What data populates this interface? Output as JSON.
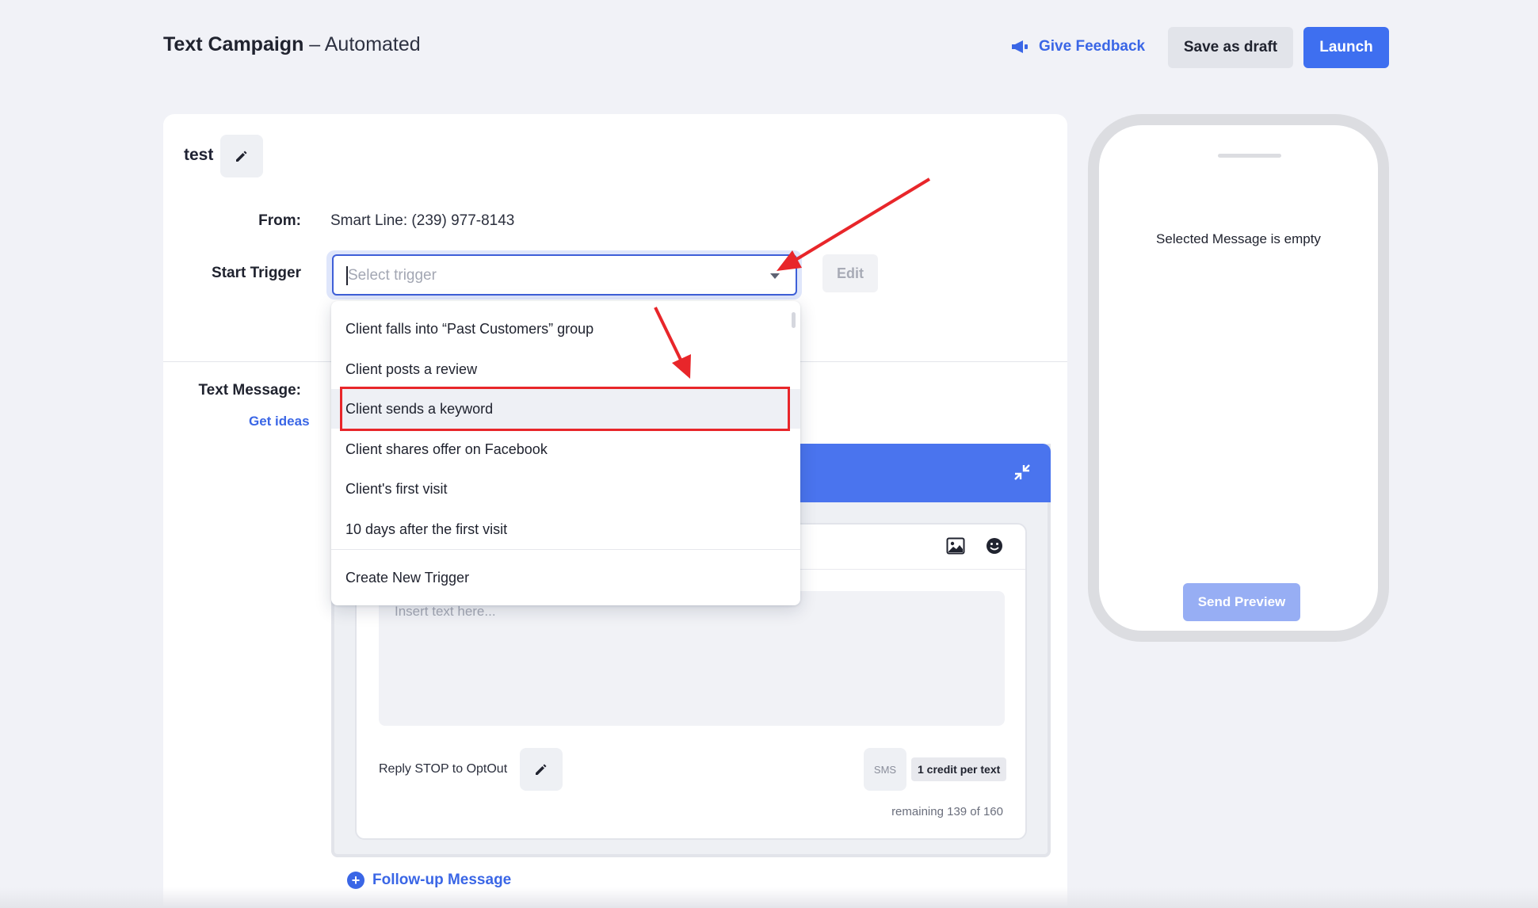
{
  "header": {
    "title_bold": "Text Campaign",
    "title_rest": " – Automated",
    "feedback_label": "Give Feedback",
    "save_draft_label": "Save as draft",
    "launch_label": "Launch"
  },
  "campaign": {
    "name": "test",
    "from_label": "From:",
    "from_value": "Smart Line: (239) 977-8143",
    "trigger_label": "Start Trigger",
    "trigger_placeholder": "Select trigger",
    "trigger_edit_label": "Edit",
    "message_label": "Text Message:",
    "get_ideas_label": "Get ideas"
  },
  "dropdown": {
    "items": [
      "Client falls into “Past Customers” group",
      "Client posts a review",
      "Client sends a keyword",
      "Client shares offer on Facebook",
      "Client's first visit",
      "10 days after the first visit"
    ],
    "highlighted_index": 2,
    "create_label": "Create New Trigger"
  },
  "editor": {
    "text_placeholder": "Insert text here...",
    "reply_stop": "Reply STOP to OptOut",
    "sms_label": "SMS",
    "credit_label": "1 credit per text",
    "remaining": "remaining 139 of 160",
    "followup_label": "Follow-up Message"
  },
  "preview": {
    "empty_message": "Selected Message is empty",
    "send_preview_label": "Send Preview"
  },
  "colors": {
    "primary": "#3e6ff0",
    "link": "#3a66e6",
    "annotation_red": "#e8262a"
  },
  "icons": [
    "megaphone-icon",
    "pencil-icon",
    "chevron-down-icon",
    "collapse-icon",
    "image-icon",
    "emoji-icon",
    "plus-circle-icon"
  ]
}
